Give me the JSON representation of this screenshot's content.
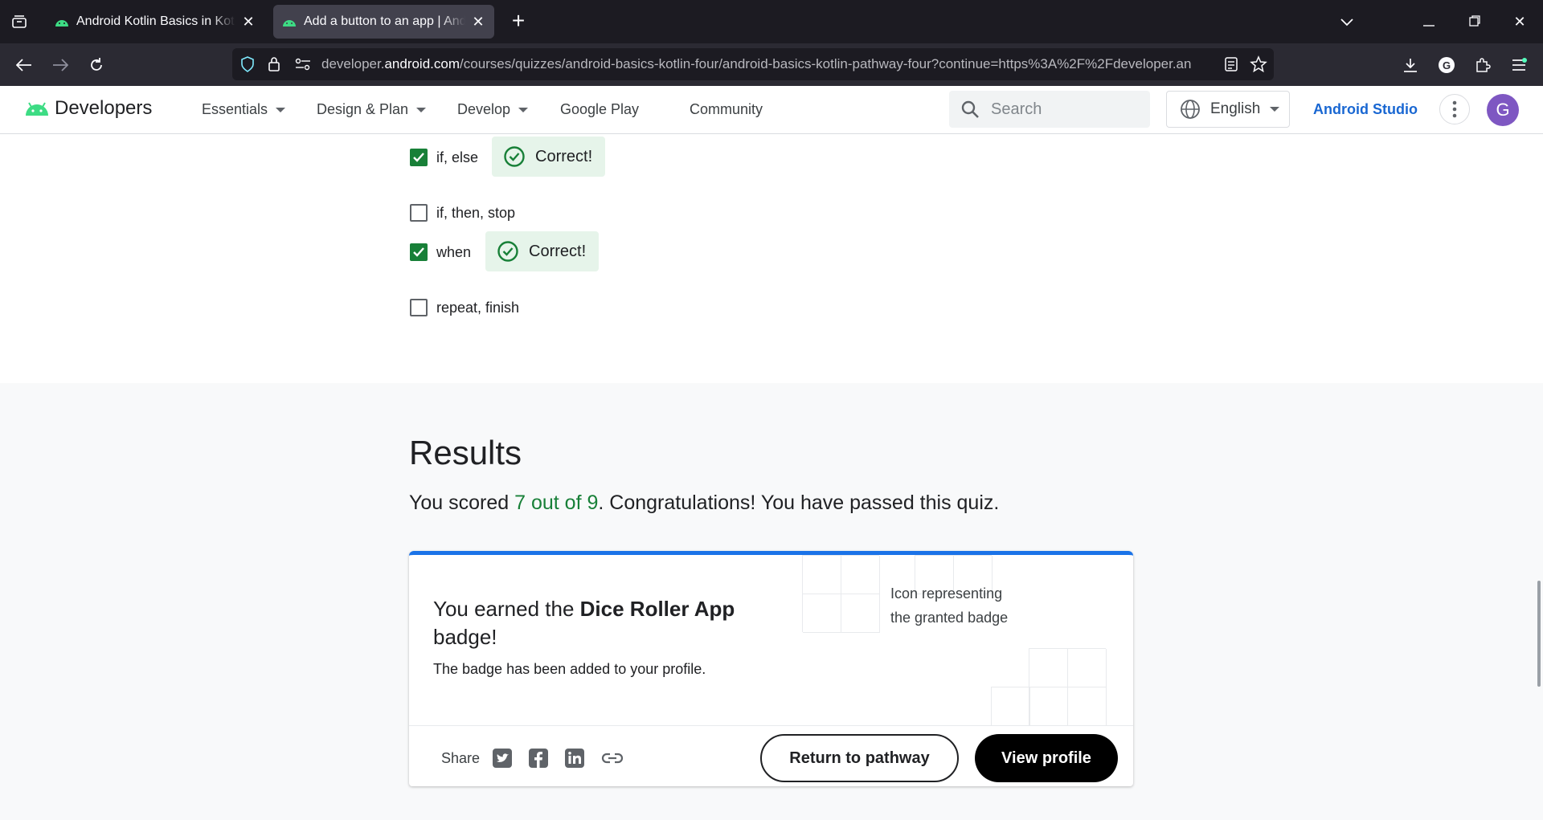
{
  "browser": {
    "tabs": [
      {
        "title": "Android Kotlin Basics in Kotlin",
        "active": false
      },
      {
        "title": "Add a button to an app  |  Android",
        "active": true
      }
    ],
    "url_prefix": "developer.",
    "url_domain": "android.com",
    "url_path": "/courses/quizzes/android-basics-kotlin-four/android-basics-kotlin-pathway-four?continue=https%3A%2F%2Fdeveloper.an"
  },
  "header": {
    "logo_text": "Developers",
    "menu": [
      "Essentials",
      "Design & Plan",
      "Develop",
      "Google Play",
      "Community"
    ],
    "search_placeholder": "Search",
    "language": "English",
    "studio_link": "Android Studio",
    "avatar_initial": "G"
  },
  "quiz": {
    "options": [
      {
        "label": "if, else",
        "checked": true,
        "feedback": "Correct!"
      },
      {
        "label": "if, then, stop",
        "checked": false
      },
      {
        "label": "when",
        "checked": true,
        "feedback": "Correct!"
      },
      {
        "label": "repeat, finish",
        "checked": false
      }
    ]
  },
  "results": {
    "title": "Results",
    "score_prefix": "You scored ",
    "score_value": "7 out of 9",
    "score_suffix": ". Congratulations! You have passed this quiz.",
    "card": {
      "title_prefix": "You earned the ",
      "badge_name": "Dice Roller App",
      "title_suffix": " badge!",
      "subtitle": "The badge has been added to your profile.",
      "badge_alt": "Icon representing the granted badge",
      "share_label": "Share",
      "return_button": "Return to pathway",
      "profile_button": "View profile"
    }
  },
  "colors": {
    "accent": "#1a73e8",
    "success": "#188038",
    "success_bg": "#e6f4ea"
  }
}
